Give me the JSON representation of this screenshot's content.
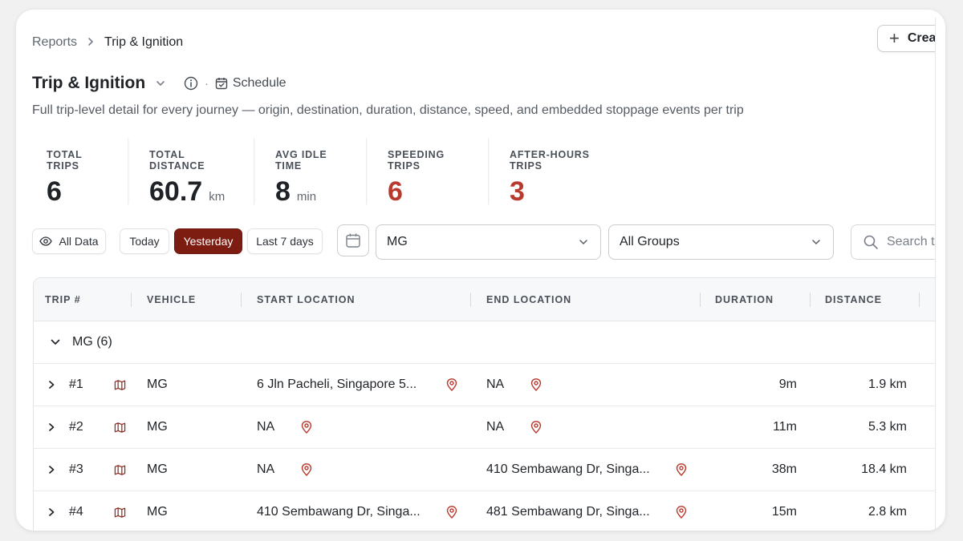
{
  "breadcrumb": {
    "root": "Reports",
    "current": "Trip & Ignition"
  },
  "header": {
    "create_label": "Crea",
    "title": "Trip & Ignition",
    "schedule_label": "Schedule",
    "description": "Full trip-level detail for every journey — origin, destination, duration, distance, speed, and embedded stoppage events per trip"
  },
  "stats": [
    {
      "label": "TOTAL TRIPS",
      "value": "6",
      "unit": ""
    },
    {
      "label": "TOTAL DISTANCE",
      "value": "60.7",
      "unit": "km"
    },
    {
      "label": "AVG IDLE TIME",
      "value": "8",
      "unit": "min"
    },
    {
      "label": "SPEEDING TRIPS",
      "value": "6",
      "unit": ""
    },
    {
      "label": "AFTER-HOURS TRIPS",
      "value": "3",
      "unit": ""
    }
  ],
  "filters": {
    "all_data": "All Data",
    "today": "Today",
    "yesterday": "Yesterday",
    "last7": "Last 7 days",
    "vehicle_select": "MG",
    "group_select": "All Groups",
    "search_placeholder": "Search tr"
  },
  "table": {
    "columns": [
      "TRIP #",
      "VEHICLE",
      "START LOCATION",
      "END LOCATION",
      "DURATION",
      "DISTANCE"
    ],
    "group_label": "MG (6)",
    "rows": [
      {
        "trip": "#1",
        "vehicle": "MG",
        "start": "6 Jln Pacheli, Singapore 5...",
        "end": "NA",
        "duration": "9m",
        "distance": "1.9 km"
      },
      {
        "trip": "#2",
        "vehicle": "MG",
        "start": "NA",
        "end": "NA",
        "duration": "11m",
        "distance": "5.3 km"
      },
      {
        "trip": "#3",
        "vehicle": "MG",
        "start": "NA",
        "end": "410 Sembawang Dr, Singa...",
        "duration": "38m",
        "distance": "18.4 km"
      },
      {
        "trip": "#4",
        "vehicle": "MG",
        "start": "410 Sembawang Dr, Singa...",
        "end": "481 Sembawang Dr, Singa...",
        "duration": "15m",
        "distance": "2.8 km"
      }
    ]
  },
  "colors": {
    "accent": "#7d1d12",
    "alert": "#b8392d"
  }
}
